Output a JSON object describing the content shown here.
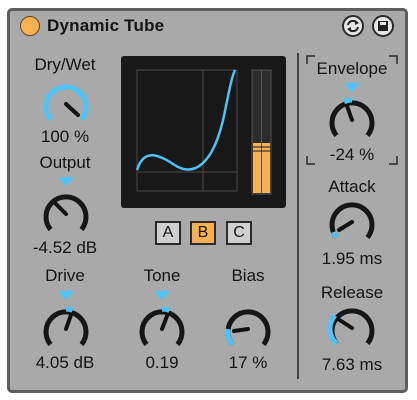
{
  "device": {
    "title": "Dynamic Tube",
    "power_on": true,
    "accent_color": "#f8b050",
    "knob_color": "#4fc3f7"
  },
  "header_icons": [
    "hot-swap-icon",
    "save-preset-icon"
  ],
  "knobs": {
    "dry_wet": {
      "label": "Dry/Wet",
      "value": "100 %"
    },
    "output": {
      "label": "Output",
      "value": "-4.52 dB"
    },
    "drive": {
      "label": "Drive",
      "value": "4.05 dB"
    },
    "tone": {
      "label": "Tone",
      "value": "0.19"
    },
    "bias": {
      "label": "Bias",
      "value": "17 %"
    },
    "envelope": {
      "label": "Envelope",
      "value": "-24 %"
    },
    "attack": {
      "label": "Attack",
      "value": "1.95 ms"
    },
    "release": {
      "label": "Release",
      "value": "7.63 ms"
    }
  },
  "tube_model": {
    "options": [
      "A",
      "B",
      "C"
    ],
    "selected": "B"
  }
}
